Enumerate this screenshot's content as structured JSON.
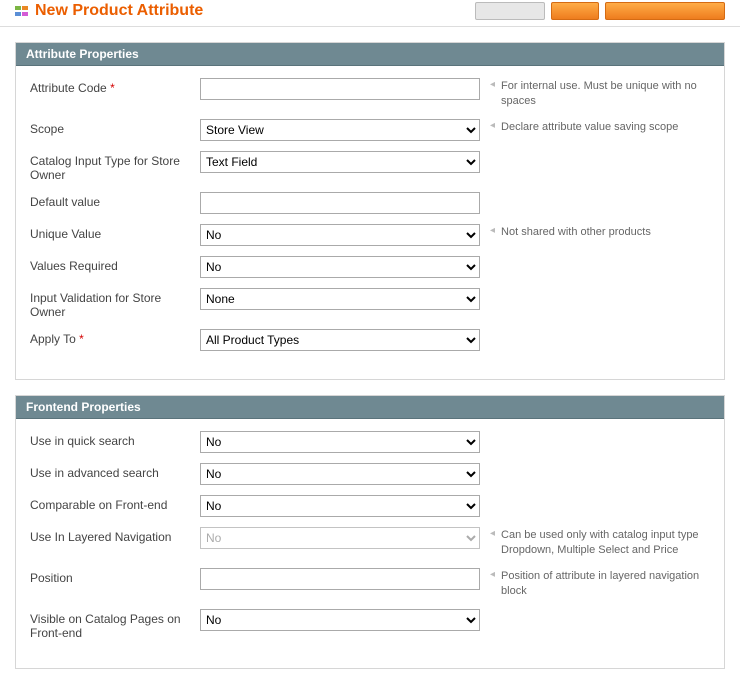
{
  "page_title": "New Product Attribute",
  "sections": {
    "attr": {
      "title": "Attribute Properties",
      "fields": {
        "attribute_code": {
          "label": "Attribute Code",
          "required": true,
          "value": "",
          "hint": "For internal use. Must be unique with no spaces"
        },
        "scope": {
          "label": "Scope",
          "value": "Store View",
          "hint": "Declare attribute value saving scope"
        },
        "input_type": {
          "label": "Catalog Input Type for Store Owner",
          "value": "Text Field"
        },
        "default_value": {
          "label": "Default value",
          "value": ""
        },
        "unique": {
          "label": "Unique Value",
          "value": "No",
          "hint": "Not shared with other products"
        },
        "required": {
          "label": "Values Required",
          "value": "No"
        },
        "validation": {
          "label": "Input Validation for Store Owner",
          "value": "None"
        },
        "apply_to": {
          "label": "Apply To",
          "required": true,
          "value": "All Product Types"
        }
      }
    },
    "front": {
      "title": "Frontend Properties",
      "fields": {
        "quick_search": {
          "label": "Use in quick search",
          "value": "No"
        },
        "adv_search": {
          "label": "Use in advanced search",
          "value": "No"
        },
        "comparable": {
          "label": "Comparable on Front-end",
          "value": "No"
        },
        "layered_nav": {
          "label": "Use In Layered Navigation",
          "value": "No",
          "disabled": true,
          "hint": "Can be used only with catalog input type Dropdown, Multiple Select and Price"
        },
        "position": {
          "label": "Position",
          "value": "",
          "hint": "Position of attribute in layered navigation block"
        },
        "visible_catalog": {
          "label": "Visible on Catalog Pages on Front-end",
          "value": "No"
        }
      }
    }
  }
}
